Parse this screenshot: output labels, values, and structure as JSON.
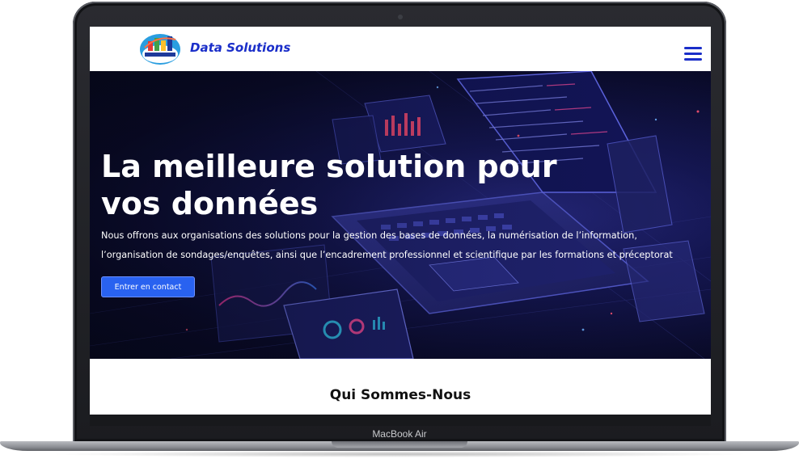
{
  "device": {
    "model_label": "MacBook Air"
  },
  "site": {
    "brand": "Data Solutions",
    "logo_text": "DATA SOLUTIONS",
    "colors": {
      "brand_blue": "#1a2ec9",
      "cta_blue": "#2962f0",
      "hero_dark": "#0a0b2a"
    },
    "menu_icon": "hamburger-menu-icon"
  },
  "hero": {
    "title_line1": "La meilleure solution pour",
    "title_line2": "vos données",
    "description": "Nous offrons aux organisations des solutions pour la gestion des bases de données, la numérisation de l’information, l’organisation de sondages/enquêtes, ainsi que l’encadrement professionnel et scientifique par les formations et préceptorat",
    "cta_label": "Entrer en contact"
  },
  "about": {
    "title": "Qui Sommes-Nous"
  }
}
